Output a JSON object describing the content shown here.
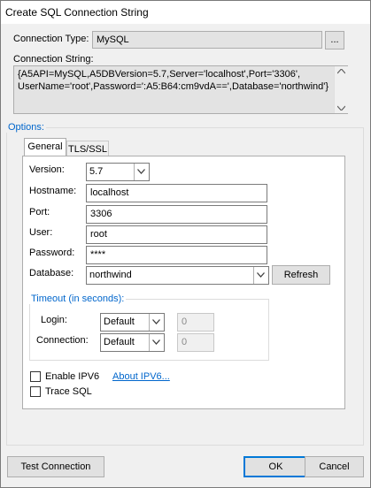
{
  "window": {
    "title": "Create SQL Connection String"
  },
  "connection_type": {
    "label": "Connection Type:",
    "value": "MySQL",
    "browse_label": "..."
  },
  "connection_string": {
    "label": "Connection String:",
    "line1": "{A5API=MySQL,A5DBVersion=5.7,Server='localhost',Port='3306',",
    "line2": "UserName='root',Password=':A5:B64:cm9vdA==',Database='northwind'}"
  },
  "options": {
    "label": "Options:"
  },
  "tabs": [
    {
      "label": "General"
    },
    {
      "label": "TLS/SSL"
    }
  ],
  "general": {
    "version": {
      "label": "Version:",
      "value": "5.7"
    },
    "hostname": {
      "label": "Hostname:",
      "value": "localhost"
    },
    "port": {
      "label": "Port:",
      "value": "3306"
    },
    "user": {
      "label": "User:",
      "value": "root"
    },
    "password": {
      "label": "Password:",
      "value": "****"
    },
    "database": {
      "label": "Database:",
      "value": "northwind",
      "refresh_label": "Refresh"
    },
    "timeout": {
      "label": "Timeout (in seconds):",
      "login": {
        "label": "Login:",
        "mode": "Default",
        "value": "0"
      },
      "connection": {
        "label": "Connection:",
        "mode": "Default",
        "value": "0"
      }
    },
    "enable_ipv6": {
      "label": "Enable IPV6",
      "checked": false
    },
    "about_ipv6": "About IPV6...",
    "trace_sql": {
      "label": "Trace SQL",
      "checked": false
    }
  },
  "buttons": {
    "test": "Test Connection",
    "ok": "OK",
    "cancel": "Cancel"
  }
}
